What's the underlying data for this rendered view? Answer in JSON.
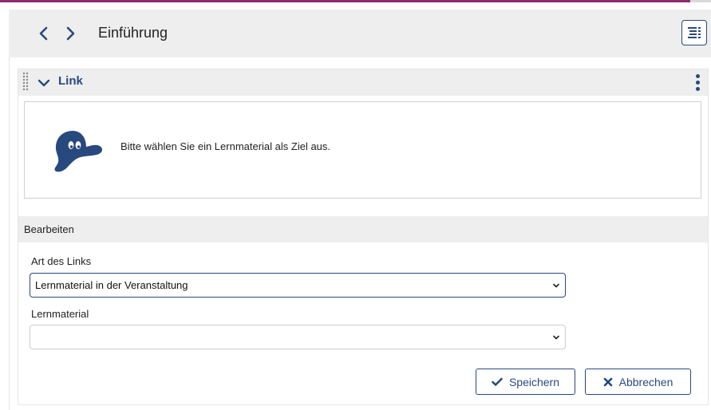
{
  "header": {
    "title": "Einführung",
    "prev_icon": "chevron-left-icon",
    "next_icon": "chevron-right-icon",
    "toc_icon": "table-of-contents-icon"
  },
  "block": {
    "title": "Link",
    "info_text": "Bitte wählen Sie ein Lernmaterial als Ziel aus."
  },
  "edit": {
    "section_label": "Bearbeiten",
    "link_type_label": "Art des Links",
    "link_type_value": "Lernmaterial in der Veranstaltung",
    "material_label": "Lernmaterial",
    "material_value": "",
    "save_label": "Speichern",
    "cancel_label": "Abbrechen"
  },
  "colors": {
    "accent": "#28497e",
    "brand_top_bar": "#8d2a74",
    "header_bg": "#eeeeee"
  }
}
